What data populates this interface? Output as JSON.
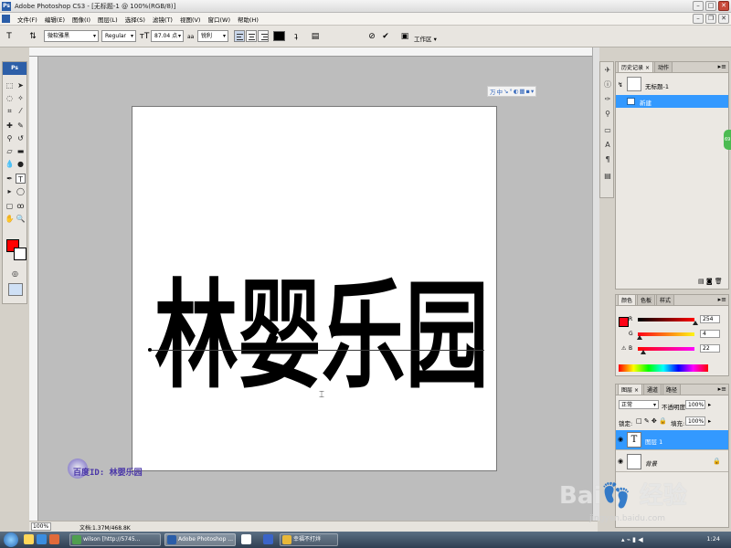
{
  "window": {
    "title": "Adobe Photoshop CS3 - [无标题-1 @ 100%(RGB/8)]",
    "badge": "Ps"
  },
  "menu": [
    "文件(F)",
    "编辑(E)",
    "图像(I)",
    "图层(L)",
    "选择(S)",
    "滤镜(T)",
    "视图(V)",
    "窗口(W)",
    "帮助(H)"
  ],
  "options": {
    "font_family": "微软雅黑",
    "font_style": "Regular",
    "font_size": "87.04 点",
    "antialias_label": "aa",
    "antialias": "锐利",
    "text_color": "#000000",
    "workspace": "工作区"
  },
  "toolbox": {
    "badge": "Ps",
    "foreground_color": "#ff0000",
    "background_color": "#ffffff"
  },
  "canvas": {
    "text": "林婴乐园"
  },
  "ime_bar": [
    "万",
    "中",
    "↘",
    "°",
    "◐",
    "▦",
    "▪",
    "▾"
  ],
  "watermark": "百度ID: 林婴乐园",
  "status": {
    "zoom": "100%",
    "doc": "文档:1.37M/468.8K"
  },
  "history": {
    "tabs": [
      "历史记录",
      "动作"
    ],
    "snapshot": "无标题-1",
    "states": [
      "新建"
    ]
  },
  "color_panel": {
    "tabs": [
      "颜色",
      "色板",
      "样式"
    ],
    "r_label": "R",
    "g_label": "G",
    "b_label": "B",
    "r": "254",
    "g": "4",
    "b": "22",
    "swatch": "#fe0416"
  },
  "layers": {
    "tabs": [
      "图层",
      "通道",
      "路径"
    ],
    "blend_mode": "正常",
    "opacity_label": "不透明度:",
    "opacity": "100%",
    "lock_label": "锁定:",
    "fill_label": "填充:",
    "fill": "100%",
    "items": [
      {
        "name": "图层 1",
        "thumb": "T"
      },
      {
        "name": "背景",
        "thumb": ""
      }
    ]
  },
  "edge_badge": "69",
  "brand": {
    "logo": "Bai👣 经验",
    "url": "jingyan.baidu.com"
  },
  "taskbar": {
    "tasks": [
      "wilson [http://5745...",
      "Adobe Photoshop ...",
      "幸福不打烊"
    ],
    "clock": "1:24"
  }
}
